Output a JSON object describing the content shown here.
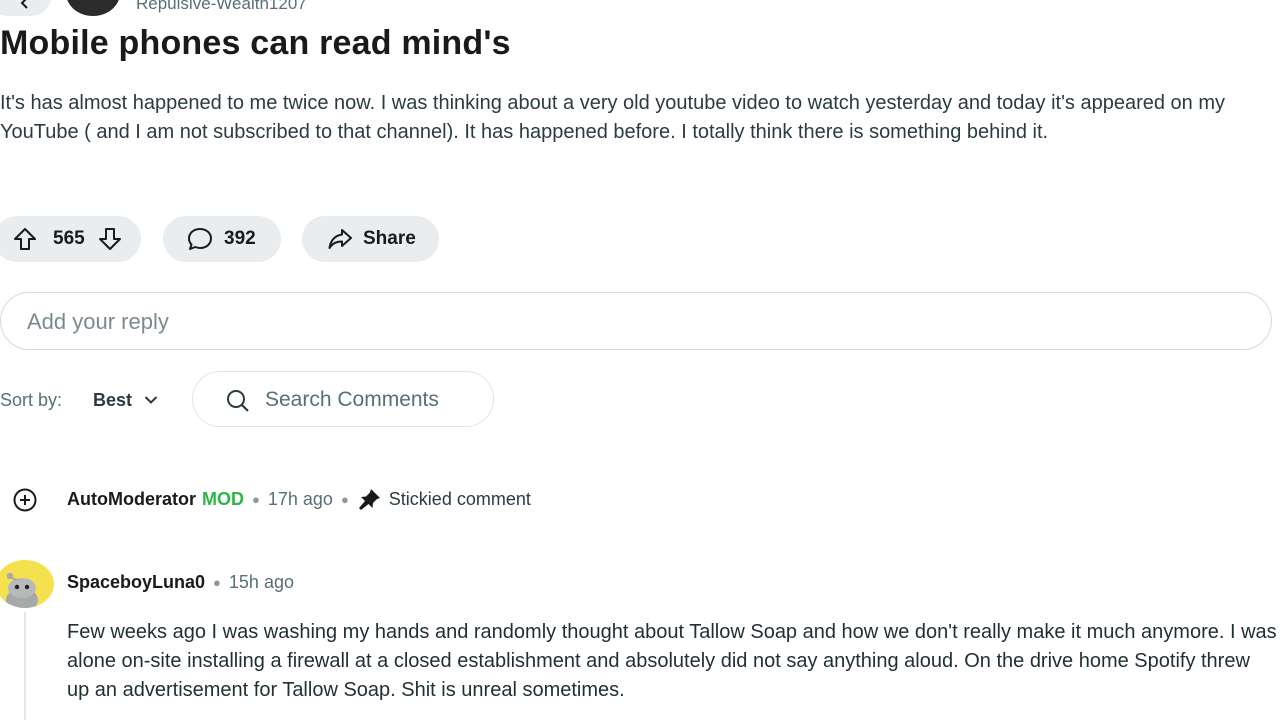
{
  "post": {
    "author": "Repulsive-Wealth1207",
    "title": "Mobile phones can read mind's",
    "body": "It's has almost happened to me twice now. I was thinking about a very old youtube video to watch yesterday and today it's appeared on my YouTube ( and I am not subscribed to that channel). It has happened before. I totally think there is something behind it."
  },
  "actions": {
    "upvotes": "565",
    "comments": "392",
    "share_label": "Share"
  },
  "reply": {
    "placeholder": "Add your reply"
  },
  "sort": {
    "label": "Sort by:",
    "value": "Best"
  },
  "search": {
    "placeholder": "Search Comments"
  },
  "comments": [
    {
      "author": "AutoModerator",
      "badge": "MOD",
      "time": "17h ago",
      "note": "Stickied comment"
    },
    {
      "author": "SpaceboyLuna0",
      "time": "15h ago",
      "body": "Few weeks ago I was washing my hands and randomly thought about Tallow Soap and how we don't really make it much anymore. I was alone on-site installing a firewall at a closed establishment and absolutely did not say anything aloud. On the drive home Spotify threw up an advertisement for Tallow Soap. Shit is unreal sometimes."
    }
  ],
  "colors": {
    "mod_badge": "#2db547",
    "pill_bg": "#eaedef",
    "meta_text": "#576f76"
  },
  "icons": [
    "back-arrow-icon",
    "upvote-icon",
    "downvote-icon",
    "comment-icon",
    "share-icon",
    "chevron-down-icon",
    "search-icon",
    "expand-plus-icon",
    "pin-icon",
    "snoo-avatar-icon"
  ]
}
